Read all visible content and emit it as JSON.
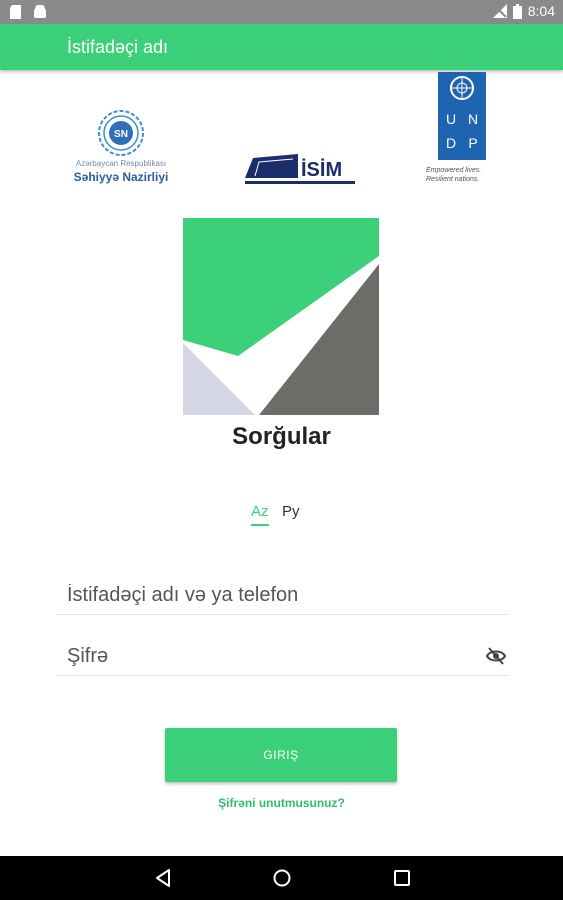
{
  "status_bar": {
    "time": "8:04",
    "icons": [
      "sd-card-icon",
      "android-icon",
      "signal-off-icon",
      "battery-icon"
    ]
  },
  "app_bar": {
    "title": "İstifadəçi adı"
  },
  "logos": {
    "ministry_line1": "Azərbaycan Respublikası",
    "ministry_line2": "Səhiyyə Nazirliyi",
    "isim": "İSİM",
    "undp_letters": [
      "U",
      "N",
      "D",
      "P"
    ],
    "undp_tagline1": "Empowered lives.",
    "undp_tagline2": "Resilient nations."
  },
  "app": {
    "name": "Sorğular"
  },
  "language": {
    "az": "Az",
    "ru": "Ру",
    "selected": "Az"
  },
  "form": {
    "username_placeholder": "İstifadəçi adı və ya telefon",
    "password_placeholder": "Şifrə",
    "login_label": "GIRIŞ",
    "forgot_label": "Şifrəni unutmusunuz?"
  },
  "colors": {
    "primary": "#3dd07b",
    "status_bar": "#8a8a8a",
    "logo_gray": "#6b6d68",
    "logo_light": "#d4d7e3"
  }
}
